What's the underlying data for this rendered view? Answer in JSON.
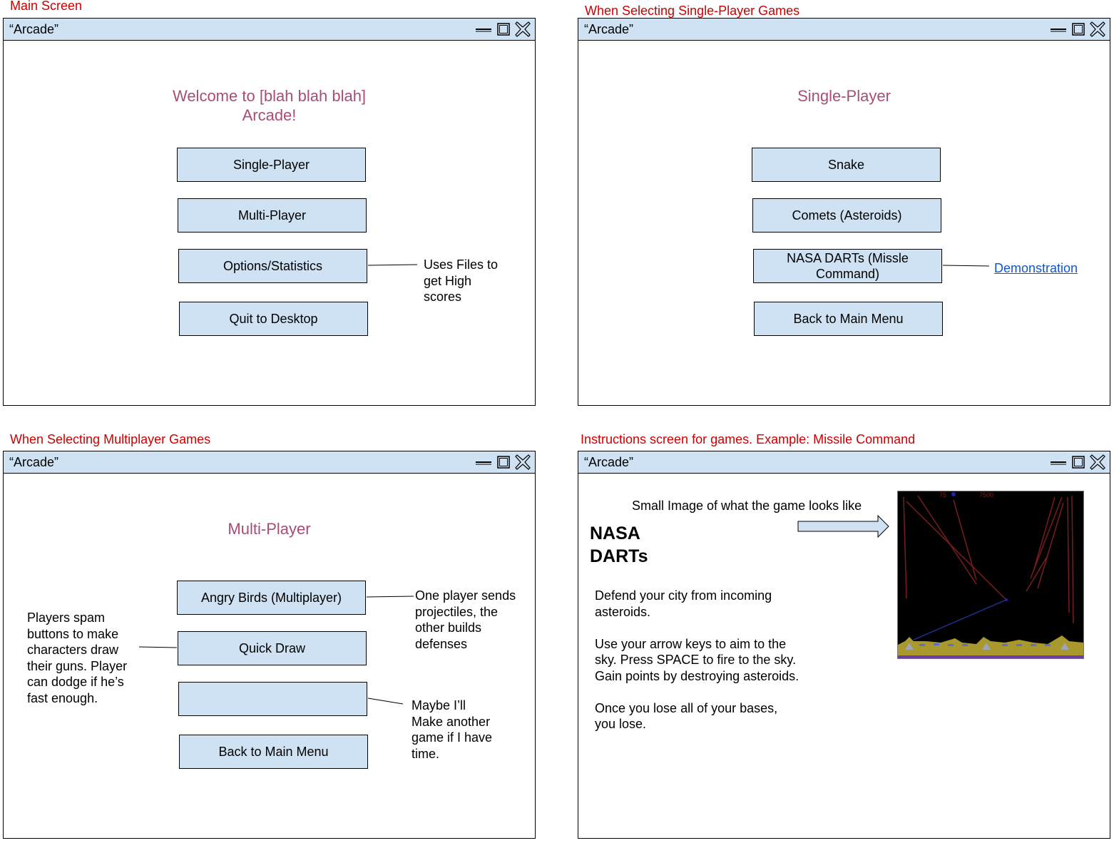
{
  "window_title": "“Arcade”",
  "captions": {
    "main": "Main Screen",
    "single": "When Selecting Single-Player Games",
    "multi": "When Selecting Multiplayer Games",
    "instructions": "Instructions screen for games. Example: Missile Command"
  },
  "main_screen": {
    "heading_line1": "Welcome to [blah blah blah]",
    "heading_line2": "Arcade!",
    "buttons": [
      "Single-Player",
      "Multi-Player",
      "Options/Statistics",
      "Quit to Desktop"
    ],
    "note": "Uses Files to get High scores"
  },
  "single_screen": {
    "heading": "Single-Player",
    "buttons": [
      "Snake",
      "Comets (Asteroids)",
      "NASA DARTs (Missle Command)",
      "Back to Main Menu"
    ],
    "link": "Demonstration"
  },
  "multi_screen": {
    "heading": "Multi-Player",
    "buttons": [
      "Angry Birds (Multiplayer)",
      "Quick Draw",
      "",
      "Back to Main Menu"
    ],
    "note_right_top": "One player sends projectiles, the other builds defenses",
    "note_left": "Players spam buttons to make characters draw their guns. Player can dodge if he’s fast enough.",
    "note_right_bottom": "Maybe I’ll Make another game if I have time."
  },
  "instructions_screen": {
    "image_note": "Small Image of what the game looks like",
    "game_title": "NASA DARTs",
    "paragraph1": "Defend your city from incoming asteroids.",
    "paragraph2": "Use your arrow keys to aim to the sky. Press SPACE to fire to the sky. Gain points by destroying asteroids.",
    "paragraph3": "Once you lose all of your bases, you lose.",
    "score_left": "75",
    "score_right": "7500"
  },
  "colors": {
    "caption": "#cc0000",
    "titlebar": "#cfe2f3",
    "button": "#cfe2f3",
    "heading": "#a64d79",
    "link": "#1155cc"
  }
}
